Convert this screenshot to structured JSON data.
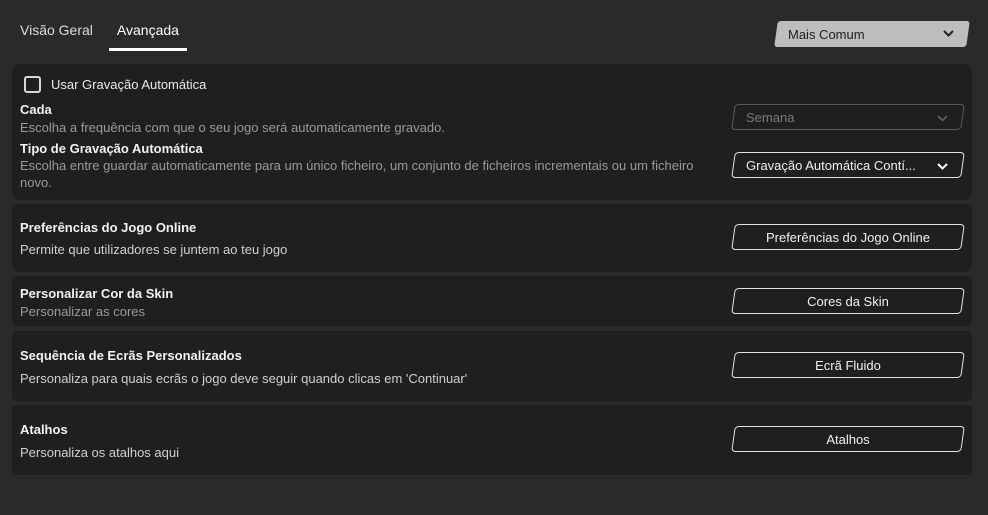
{
  "tabs": [
    {
      "label": "Visão Geral",
      "active": false
    },
    {
      "label": "Avançada",
      "active": true
    }
  ],
  "preset": {
    "value": "Mais Comum",
    "icon": "chevron-down-icon"
  },
  "autosave": {
    "checkbox_label": "Usar Gravação Automática",
    "checked": false,
    "every": {
      "title": "Cada",
      "description": "Escolha a frequência com que o seu jogo será automaticamente gravado.",
      "value": "Semana",
      "disabled": true
    },
    "type": {
      "title": "Tipo de Gravação Automática",
      "description": "Escolha entre guardar automaticamente para um único ficheiro, um conjunto de ficheiros incrementais ou um ficheiro novo.",
      "value": "Gravação Automática Contí..."
    }
  },
  "online": {
    "title": "Preferências do Jogo Online",
    "description": "Permite que utilizadores se juntem ao teu jogo",
    "button": "Preferências do Jogo Online"
  },
  "skin": {
    "title": "Personalizar Cor da Skin",
    "description": "Personalizar as cores",
    "button": "Cores da Skin"
  },
  "screens": {
    "title": "Sequência de Ecrãs Personalizados",
    "description": "Personaliza para quais ecrãs o jogo deve seguir quando clicas em 'Continuar'",
    "button": "Ecrã Fluido"
  },
  "shortcuts": {
    "title": "Atalhos",
    "description": "Personaliza os atalhos aqui",
    "button": "Atalhos"
  },
  "colors": {
    "background": "#2a2a2a",
    "panel": "#1f1f1f",
    "preset_bg": "#bdbdbd"
  }
}
